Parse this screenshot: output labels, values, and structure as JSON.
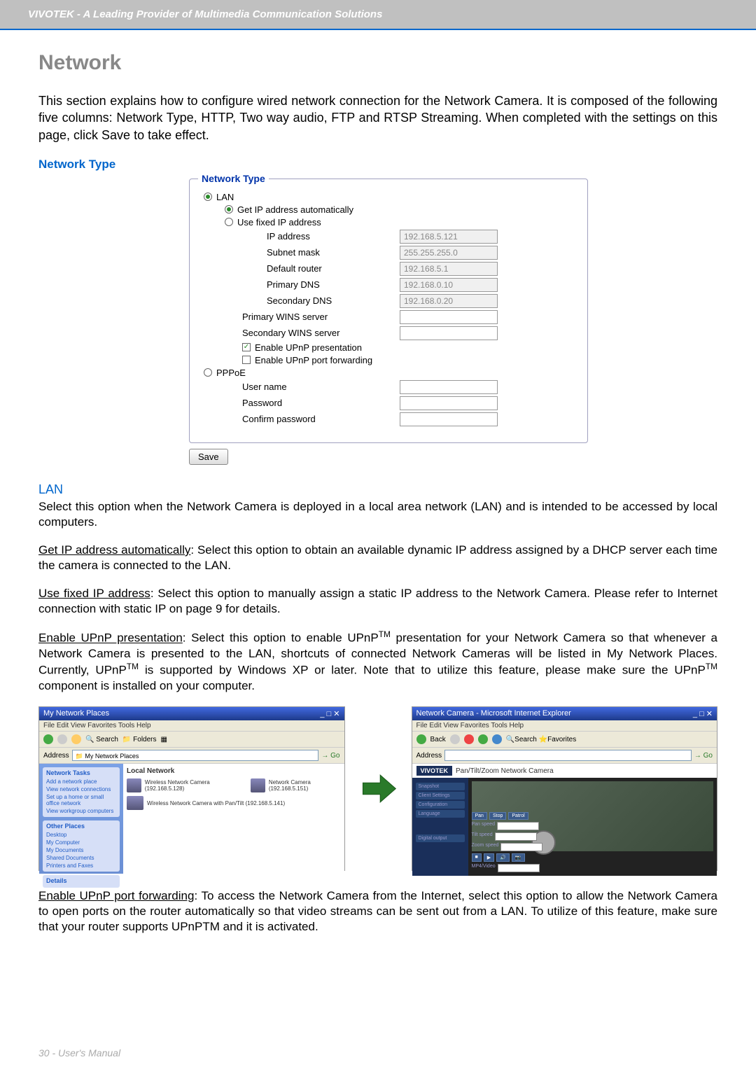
{
  "header": {
    "banner": "VIVOTEK - A Leading Provider of Multimedia Communication Solutions"
  },
  "title": "Network",
  "intro": "This section explains how to configure wired network connection for the Network Camera. It is composed of the following five columns: Network Type, HTTP, Two way audio, FTP and RTSP Streaming. When completed with the settings on this page, click Save to take effect.",
  "section_title": "Network Type",
  "form": {
    "legend": "Network Type",
    "lan_label": "LAN",
    "get_ip_label": "Get IP address automatically",
    "fixed_ip_label": "Use fixed IP address",
    "ip_label": "IP address",
    "ip_value": "192.168.5.121",
    "subnet_label": "Subnet mask",
    "subnet_value": "255.255.255.0",
    "router_label": "Default router",
    "router_value": "192.168.5.1",
    "pdns_label": "Primary DNS",
    "pdns_value": "192.168.0.10",
    "sdns_label": "Secondary DNS",
    "sdns_value": "192.168.0.20",
    "pwins_label": "Primary WINS server",
    "swins_label": "Secondary WINS server",
    "upnp_pres_label": "Enable UPnP presentation",
    "upnp_port_label": "Enable UPnP port forwarding",
    "pppoe_label": "PPPoE",
    "username_label": "User name",
    "password_label": "Password",
    "confirm_label": "Confirm password",
    "save_label": "Save"
  },
  "lan": {
    "heading": "LAN",
    "desc": "Select this option when the Network Camera is deployed in a local area network (LAN) and is intended to be accessed by local computers.",
    "get_ip_u": "Get IP address automatically",
    "get_ip_rest": ": Select this option to obtain an available dynamic IP address assigned by a DHCP server each time the camera is connected to the LAN.",
    "fixed_u": "Use fixed IP address",
    "fixed_rest": ": Select this option to manually assign a static IP address to the Network Camera. Please refer to Internet connection with static IP on page 9 for details.",
    "upnp_u": "Enable UPnP presentation",
    "upnp_rest1": ": Select this option to enable UPnP",
    "upnp_rest2": " presentation for your Network Camera so that whenever a Network Camera is presented to the LAN, shortcuts of connected Network Cameras will be listed in My Network Places. Currently, UPnP",
    "upnp_rest3": " is supported by Windows XP or later. Note that to utilize this feature, please make sure the UPnP",
    "upnp_rest4": " component is installed on your computer.",
    "port_u": "Enable UPnP port forwarding",
    "port_rest": ": To access the Network Camera from the Internet, select this option to allow the Network Camera to open ports on the router automatically so that video streams can be sent out from a LAN. To utilize of this feature, make sure that your router supports UPnPTM and it is activated."
  },
  "screenshots": {
    "left_title": "My Network Places",
    "left_menu": "File   Edit   View   Favorites   Tools   Help",
    "left_address_label": "Address",
    "local_network": "Local Network",
    "network_tasks": "Network Tasks",
    "other_places": "Other Places",
    "dev1": "Wireless Network Camera (192.168.5.128)",
    "dev2": "Network Camera (192.168.5.151)",
    "dev3": "Wireless Network Camera with Pan/Tilt (192.168.5.141)",
    "sidebar_tasks": [
      "Add a network place",
      "View network connections",
      "Set up a home or small office network",
      "View workgroup computers"
    ],
    "sidebar_places": [
      "Desktop",
      "My Computer",
      "My Documents",
      "Shared Documents",
      "Printers and Faxes"
    ],
    "details_label": "Details",
    "right_title": "Network Camera - Microsoft Internet Explorer",
    "right_menu": "File   Edit   View   Favorites   Tools   Help",
    "right_toolbar": "Back",
    "vivotek": "VIVOTEK",
    "camera_title": "Pan/Tilt/Zoom Network Camera",
    "nav_items": [
      "Snapshot",
      "Client Settings",
      "Configuration",
      "Language"
    ],
    "ctrl_pan": "Pan",
    "ctrl_stop": "Stop",
    "ctrl_patrol": "Patrol",
    "ptz_labels": [
      "Pan speed",
      "Tilt speed",
      "Zoom speed"
    ]
  },
  "footer": "30 - User's Manual"
}
